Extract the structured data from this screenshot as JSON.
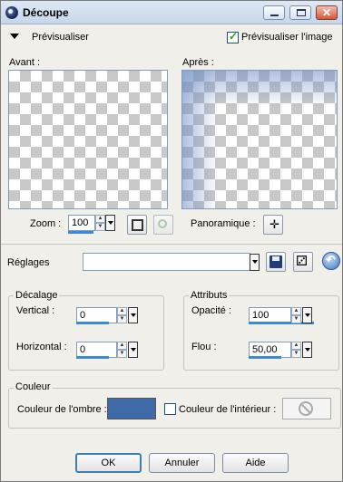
{
  "window": {
    "title": "Découpe"
  },
  "preview": {
    "toggle_label": "Prévisualiser",
    "checkbox_label": "Prévisualiser l'image",
    "checkbox_checked": true,
    "before_label": "Avant :",
    "after_label": "Après :",
    "zoom_label": "Zoom :",
    "zoom_value": "100",
    "pan_label": "Panoramique :"
  },
  "presets": {
    "label": "Réglages",
    "value": ""
  },
  "offset": {
    "title": "Décalage",
    "vertical_label": "Vertical :",
    "vertical_value": "0",
    "horizontal_label": "Horizontal :",
    "horizontal_value": "0"
  },
  "attributes": {
    "title": "Attributs",
    "opacity_label": "Opacité :",
    "opacity_value": "100",
    "blur_label": "Flou :",
    "blur_value": "50,00"
  },
  "color": {
    "title": "Couleur",
    "shadow_label": "Couleur de l'ombre :",
    "shadow_color": "#3e6aa8",
    "interior_label": "Couleur de l'intérieur :",
    "interior_checked": false
  },
  "buttons": {
    "ok": "OK",
    "cancel": "Annuler",
    "help": "Aide"
  }
}
